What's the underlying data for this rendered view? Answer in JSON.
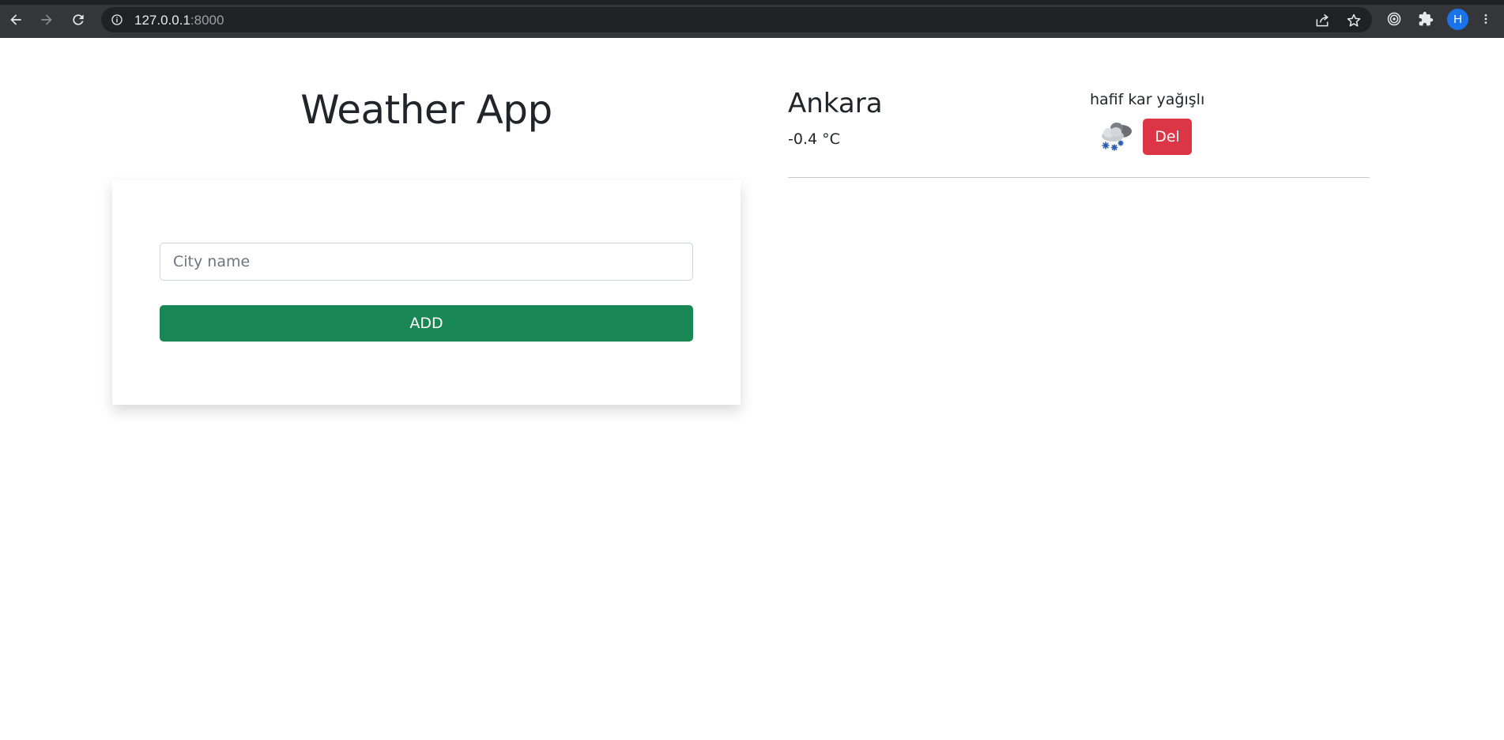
{
  "browser": {
    "url_host": "127.0.0.1",
    "url_port": ":8000",
    "profile_initial": "H",
    "icons": {
      "back": "back-arrow-icon",
      "forward": "forward-arrow-icon",
      "reload": "reload-icon",
      "site_info": "info-icon",
      "share": "share-icon",
      "bookmark": "star-icon",
      "extension_1": "target-icon",
      "extensions": "puzzle-icon",
      "menu": "kebab-menu-icon"
    }
  },
  "app": {
    "title": "Weather App",
    "form": {
      "city_placeholder": "City name",
      "city_value": "",
      "add_label": "ADD"
    },
    "accent_colors": {
      "add": "#198754",
      "delete": "#dc3545"
    }
  },
  "cities": [
    {
      "name": "Ankara",
      "temperature": "-0.4 °C",
      "description": "hafif kar yağışlı",
      "icon": "snow-cloud-icon",
      "delete_label": "Del"
    }
  ]
}
